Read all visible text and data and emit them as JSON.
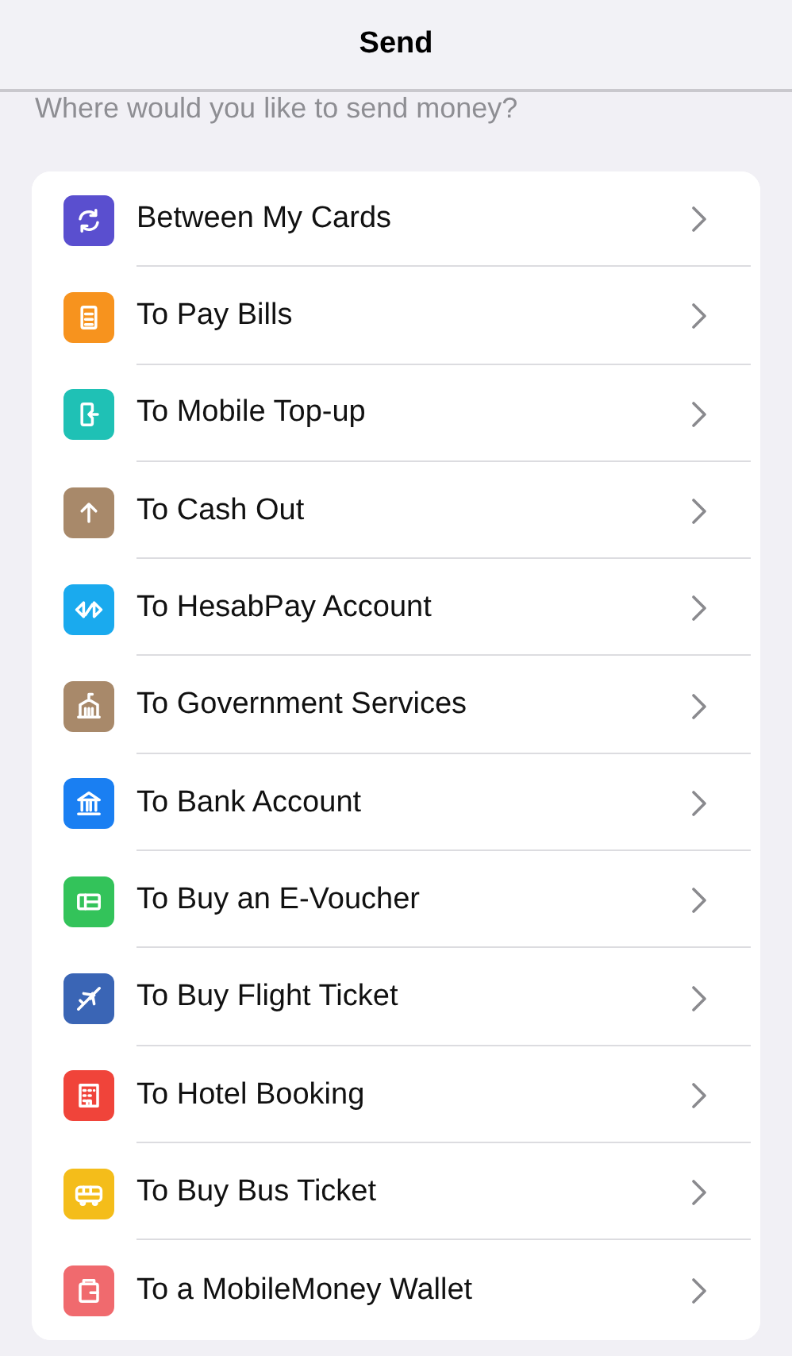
{
  "header": {
    "title": "Send"
  },
  "prompt": "Where would you like to send money?",
  "options": [
    {
      "label": "Between My Cards",
      "kind": "cycle",
      "color": "#5a4fcf"
    },
    {
      "label": "To Pay Bills",
      "kind": "document",
      "color": "#f7931e"
    },
    {
      "label": "To Mobile Top-up",
      "kind": "phone",
      "color": "#1fc1b5"
    },
    {
      "label": "To Cash Out",
      "kind": "arrow",
      "color": "#a8896a"
    },
    {
      "label": "To HesabPay Account",
      "kind": "transfer",
      "color": "#1aaaee"
    },
    {
      "label": "To Government Services",
      "kind": "building",
      "color": "#a8896a"
    },
    {
      "label": "To Bank Account",
      "kind": "bank",
      "color": "#1a7ff2"
    },
    {
      "label": "To Buy an E-Voucher",
      "kind": "voucher",
      "color": "#33c35a"
    },
    {
      "label": "To Buy Flight Ticket",
      "kind": "plane",
      "color": "#3a65b5"
    },
    {
      "label": "To Hotel Booking",
      "kind": "hotel",
      "color": "#f0443a"
    },
    {
      "label": "To Buy Bus Ticket",
      "kind": "bus",
      "color": "#f4bd1a"
    },
    {
      "label": "To a MobileMoney Wallet",
      "kind": "wallet",
      "color": "#f06a6e"
    }
  ]
}
